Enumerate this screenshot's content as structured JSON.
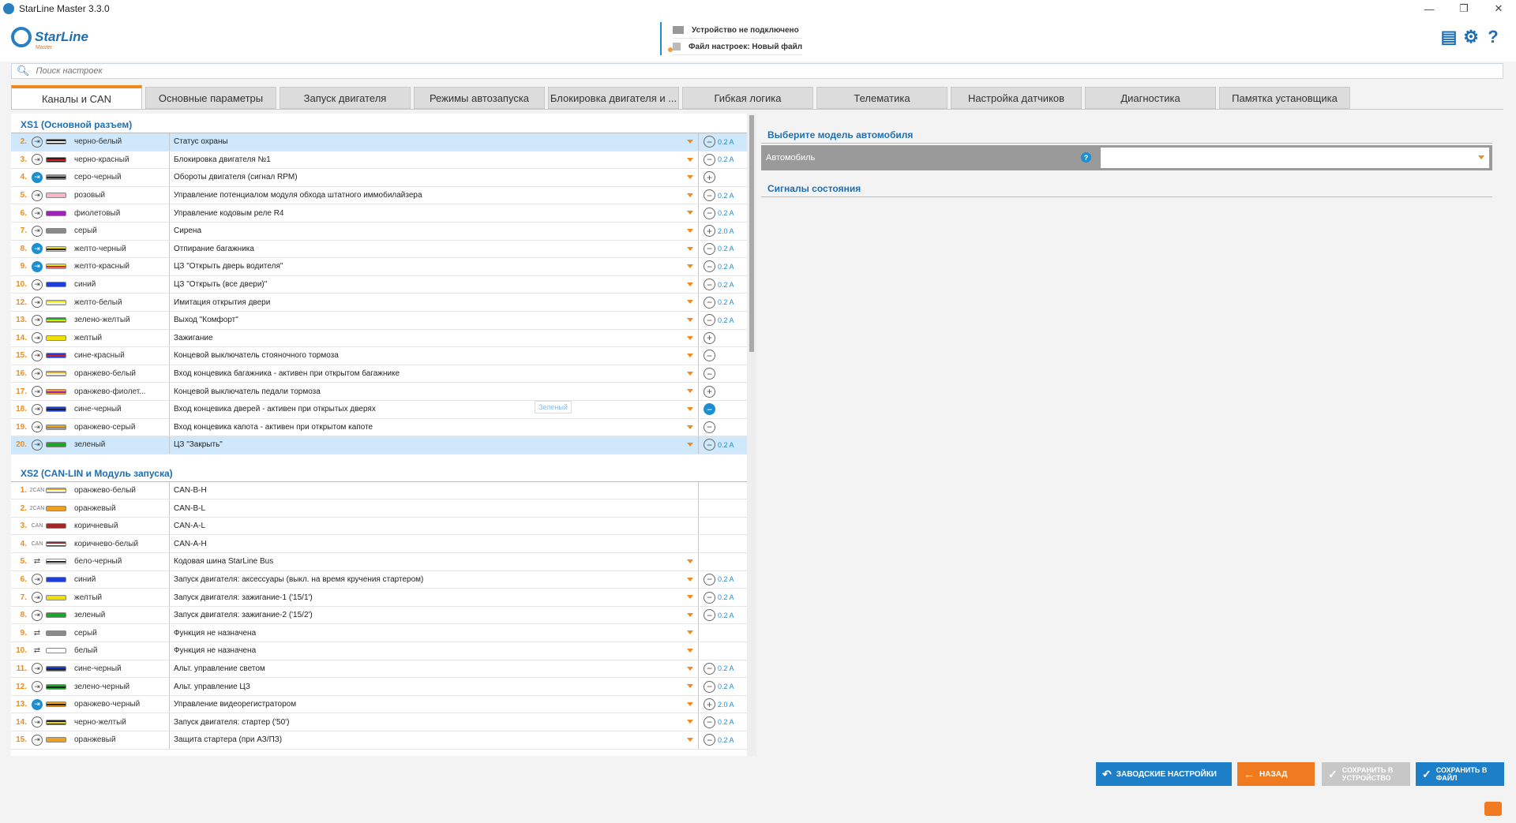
{
  "titlebar": {
    "title": "StarLine Master 3.3.0",
    "minimize": "—",
    "maximize": "❐",
    "close": "✕"
  },
  "header": {
    "logo_text": "StarLine",
    "logo_sub": "Master",
    "device_status": "Устройство не подключено",
    "settings_file": "Файл настроек: Новый файл"
  },
  "search": {
    "placeholder": "Поиск настроек"
  },
  "tabs": [
    "Каналы и CAN",
    "Основные параметры",
    "Запуск двигателя",
    "Режимы автозапуска",
    "Блокировка двигателя и ...",
    "Гибкая логика",
    "Телематика",
    "Настройка датчиков",
    "Диагностика",
    "Памятка установщика"
  ],
  "xs1": {
    "title": "XS1 (Основной разъем)",
    "rows": [
      {
        "num": "2.",
        "dir": "out",
        "color": "черно-белый",
        "c1": "#222222",
        "c2": "#ffffff",
        "func": "Статус охраны",
        "pm": "-",
        "cur": "0.2 A",
        "sel": true
      },
      {
        "num": "3.",
        "dir": "out",
        "color": "черно-красный",
        "c1": "#222222",
        "c2": "#d02020",
        "func": "Блокировка двигателя №1",
        "pm": "-",
        "cur": "0.2 A"
      },
      {
        "num": "4.",
        "dir": "in",
        "color": "серо-черный",
        "c1": "#8a8a8a",
        "c2": "#222222",
        "func": "Обороты двигателя (сигнал RPM)",
        "pm": "+",
        "cur": ""
      },
      {
        "num": "5.",
        "dir": "out",
        "color": "розовый",
        "c1": "#f7b6c2",
        "c2": "",
        "func": "Управление потенциалом модуля обхода штатного иммобилайзера",
        "pm": "-",
        "cur": "0.2 A"
      },
      {
        "num": "6.",
        "dir": "out",
        "color": "фиолетовый",
        "c1": "#9b23b5",
        "c2": "",
        "func": "Управление кодовым реле R4",
        "pm": "-",
        "cur": "0.2 A"
      },
      {
        "num": "7.",
        "dir": "out",
        "color": "серый",
        "c1": "#8a8a8a",
        "c2": "",
        "func": "Сирена",
        "pm": "+",
        "cur": "2.0 A"
      },
      {
        "num": "8.",
        "dir": "in",
        "color": "желто-черный",
        "c1": "#f0e000",
        "c2": "#222222",
        "func": "Отпирание багажника",
        "pm": "-",
        "cur": "0.2 A"
      },
      {
        "num": "9.",
        "dir": "in",
        "color": "желто-красный",
        "c1": "#f0e000",
        "c2": "#d02020",
        "func": "ЦЗ \"Открыть дверь водителя\"",
        "pm": "-",
        "cur": "0.2 A"
      },
      {
        "num": "10.",
        "dir": "out",
        "color": "синий",
        "c1": "#1f3fd8",
        "c2": "",
        "func": "ЦЗ \"Открыть (все двери)\"",
        "pm": "-",
        "cur": "0.2 A"
      },
      {
        "num": "12.",
        "dir": "out",
        "color": "желто-белый",
        "c1": "#f0e000",
        "c2": "#ffffff",
        "func": "Имитация открытия двери",
        "pm": "-",
        "cur": "0.2 A"
      },
      {
        "num": "13.",
        "dir": "out",
        "color": "зелено-желтый",
        "c1": "#1aa626",
        "c2": "#f0e000",
        "func": "Выход \"Комфорт\"",
        "pm": "-",
        "cur": "0.2 A"
      },
      {
        "num": "14.",
        "dir": "out",
        "color": "желтый",
        "c1": "#f0e000",
        "c2": "",
        "func": "Зажигание",
        "pm": "+",
        "cur": ""
      },
      {
        "num": "15.",
        "dir": "out",
        "color": "сине-красный",
        "c1": "#1f3fd8",
        "c2": "#d02020",
        "func": "Концевой выключатель стояночного тормоза",
        "pm": "-",
        "cur": ""
      },
      {
        "num": "16.",
        "dir": "out",
        "color": "оранжево-белый",
        "c1": "#f0a020",
        "c2": "#ffffff",
        "func": "Вход концевика багажника - активен при открытом багажнике",
        "pm": "-",
        "cur": ""
      },
      {
        "num": "17.",
        "dir": "out",
        "color": "оранжево-фиолет...",
        "c1": "#f0a020",
        "c2": "#9b23b5",
        "func": "Концевой выключатель педали тормоза",
        "pm": "+",
        "cur": ""
      },
      {
        "num": "18.",
        "dir": "out",
        "color": "сине-черный",
        "c1": "#1f3fd8",
        "c2": "#222222",
        "func": "Вход концевика дверей - активен при открытых дверях",
        "pm": "-b",
        "cur": "",
        "tip": "Зеленый"
      },
      {
        "num": "19.",
        "dir": "out",
        "color": "оранжево-серый",
        "c1": "#f0a020",
        "c2": "#8a8a8a",
        "func": "Вход концевика капота - активен при открытом капоте",
        "pm": "-",
        "cur": ""
      },
      {
        "num": "20.",
        "dir": "out",
        "color": "зеленый",
        "c1": "#1aa626",
        "c2": "",
        "func": "ЦЗ \"Закрыть\"",
        "pm": "-",
        "cur": "0.2 A",
        "sel": true
      }
    ]
  },
  "xs2": {
    "title": "XS2 (CAN-LIN и Модуль запуска)",
    "rows": [
      {
        "num": "1.",
        "dir": "2CAN",
        "color": "оранжево-белый",
        "c1": "#f0a020",
        "c2": "#ffffff",
        "func": "CAN-B-H",
        "pm": "",
        "cur": "",
        "noarr": true
      },
      {
        "num": "2.",
        "dir": "2CAN",
        "color": "оранжевый",
        "c1": "#f0a020",
        "c2": "",
        "func": "CAN-B-L",
        "pm": "",
        "cur": "",
        "noarr": true
      },
      {
        "num": "3.",
        "dir": "CAN",
        "color": "коричневый",
        "c1": "#a02828",
        "c2": "",
        "func": "CAN-A-L",
        "pm": "",
        "cur": "",
        "noarr": true
      },
      {
        "num": "4.",
        "dir": "CAN",
        "color": "коричнево-белый",
        "c1": "#a02828",
        "c2": "#ffffff",
        "func": "CAN-A-H",
        "pm": "",
        "cur": "",
        "noarr": true
      },
      {
        "num": "5.",
        "dir": "bi",
        "color": "бело-черный",
        "c1": "#ffffff",
        "c2": "#222222",
        "func": "Кодовая шина StarLine Bus",
        "pm": "",
        "cur": ""
      },
      {
        "num": "6.",
        "dir": "out",
        "color": "синий",
        "c1": "#1f3fd8",
        "c2": "",
        "func": "Запуск двигателя: аксессуары (выкл. на время кручения стартером)",
        "pm": "-",
        "cur": "0.2 A"
      },
      {
        "num": "7.",
        "dir": "out",
        "color": "желтый",
        "c1": "#f0e000",
        "c2": "",
        "func": "Запуск двигателя: зажигание-1 ('15/1')",
        "pm": "-",
        "cur": "0.2 A"
      },
      {
        "num": "8.",
        "dir": "out",
        "color": "зеленый",
        "c1": "#1aa626",
        "c2": "",
        "func": "Запуск двигателя: зажигание-2 ('15/2')",
        "pm": "-",
        "cur": "0.2 A"
      },
      {
        "num": "9.",
        "dir": "bi",
        "color": "серый",
        "c1": "#8a8a8a",
        "c2": "",
        "func": "Функция не назначена",
        "pm": "",
        "cur": ""
      },
      {
        "num": "10.",
        "dir": "bi",
        "color": "белый",
        "c1": "#ffffff",
        "c2": "",
        "func": "Функция не назначена",
        "pm": "",
        "cur": ""
      },
      {
        "num": "11.",
        "dir": "out",
        "color": "сине-черный",
        "c1": "#1f3fd8",
        "c2": "#222222",
        "func": "Альт. управление светом",
        "pm": "-",
        "cur": "0.2 A"
      },
      {
        "num": "12.",
        "dir": "out",
        "color": "зелено-черный",
        "c1": "#1aa626",
        "c2": "#222222",
        "func": "Альт. управление ЦЗ",
        "pm": "-",
        "cur": "0.2 A"
      },
      {
        "num": "13.",
        "dir": "in",
        "color": "оранжево-черный",
        "c1": "#f0a020",
        "c2": "#222222",
        "func": "Управление видеорегистратором",
        "pm": "+",
        "cur": "2.0 A"
      },
      {
        "num": "14.",
        "dir": "out",
        "color": "черно-желтый",
        "c1": "#222222",
        "c2": "#f0e000",
        "func": "Запуск двигателя: стартер ('50')",
        "pm": "-",
        "cur": "0.2 A"
      },
      {
        "num": "15.",
        "dir": "out",
        "color": "оранжевый",
        "c1": "#f0a020",
        "c2": "",
        "func": "Защита стартера (при АЗ/ПЗ)",
        "pm": "-",
        "cur": "0.2 A"
      }
    ]
  },
  "right": {
    "car_title": "Выберите модель автомобиля",
    "car_label": "Автомобиль",
    "car_value": "",
    "signals_title": "Сигналы состояния"
  },
  "footer": {
    "factory": "ЗАВОДСКИЕ НАСТРОЙКИ",
    "back": "НАЗАД",
    "save_device": "СОХРАНИТЬ В УСТРОЙСТВО",
    "save_file": "СОХРАНИТЬ В ФАЙЛ"
  }
}
